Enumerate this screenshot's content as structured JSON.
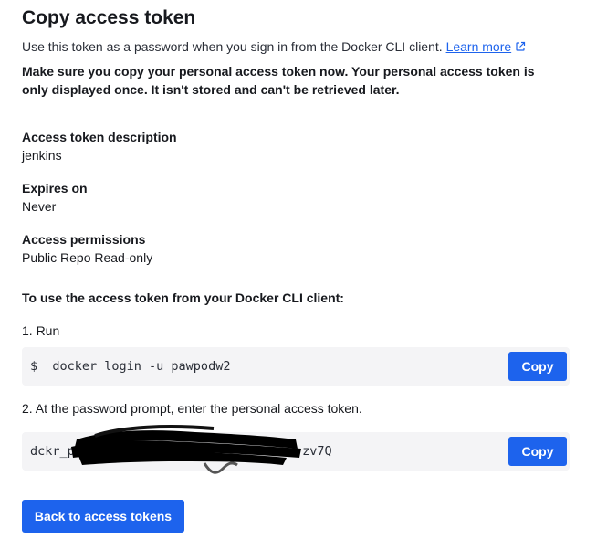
{
  "header": {
    "title": "Copy access token",
    "subtitle": "Use this token as a password when you sign in from the Docker CLI client.",
    "learn_more": "Learn more",
    "external_icon": "external-link-icon"
  },
  "warning": "Make sure you copy your personal access token now. Your personal access token is only displayed once. It isn't stored and can't be retrieved later.",
  "details": {
    "description_label": "Access token description",
    "description_value": "jenkins",
    "expires_label": "Expires on",
    "expires_value": "Never",
    "permissions_label": "Access permissions",
    "permissions_value": "Public Repo Read-only"
  },
  "instructions": {
    "heading": "To use the access token from your Docker CLI client:",
    "step1": "1. Run",
    "command": "$  docker login -u pawpodw2",
    "copy_label": "Copy",
    "step2": "2. At the password prompt, enter the personal access token.",
    "token_prefix": "dckr_pat_",
    "token_suffix": "zv7Q"
  },
  "colors": {
    "accent": "#1d63ed",
    "code_bg": "#f4f4f6",
    "text": "#17191e"
  },
  "back_button": "Back to access tokens"
}
